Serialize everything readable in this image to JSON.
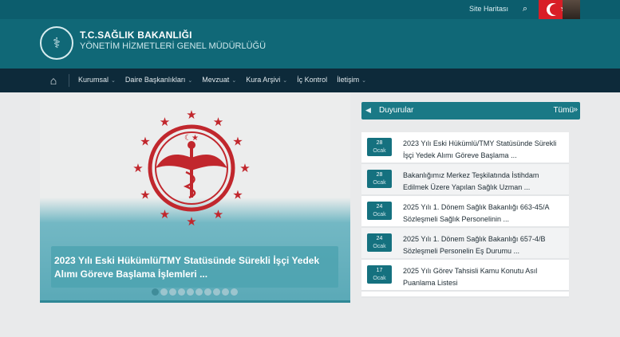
{
  "topbar": {
    "sitemap_label": "Site Haritası",
    "search_icon": "search-icon"
  },
  "header": {
    "title": "T.C.SAĞLIK BAKANLIĞI",
    "subtitle": "YÖNETİM HİZMETLERİ GENEL MÜDÜRLÜĞÜ"
  },
  "nav": {
    "home_icon": "home-icon",
    "items": [
      {
        "label": "Kurumsal",
        "has_menu": true
      },
      {
        "label": "Daire Başkanlıkları",
        "has_menu": true
      },
      {
        "label": "Mevzuat",
        "has_menu": true
      },
      {
        "label": "Kura Arşivi",
        "has_menu": true
      },
      {
        "label": "İç Kontrol",
        "has_menu": false
      },
      {
        "label": "İletişim",
        "has_menu": true
      }
    ]
  },
  "slider": {
    "caption": "2023 Yılı Eski Hükümlü/TMY Statüsünde Sürekli İşçi Yedek Alımı Göreve Başlama İşlemleri ...",
    "dot_count": 10,
    "active_dot": 0,
    "emblem_color": "#c1272d"
  },
  "announcements": {
    "title": "Duyurular",
    "all_label": "Tümü",
    "items": [
      {
        "day": "28",
        "month": "Ocak",
        "title": "2023 Yılı Eski Hükümlü/TMY Statüsünde Sürekli İşçi Yedek Alımı Göreve Başlama ..."
      },
      {
        "day": "28",
        "month": "Ocak",
        "title": "Bakanlığımız Merkez Teşkilatında İstihdam Edilmek Üzere Yapılan Sağlık Uzman ..."
      },
      {
        "day": "24",
        "month": "Ocak",
        "title": "2025 Yılı 1. Dönem Sağlık Bakanlığı 663-45/A Sözleşmeli Sağlık Personelinin ..."
      },
      {
        "day": "24",
        "month": "Ocak",
        "title": "2025 Yılı 1. Dönem Sağlık Bakanlığı 657-4/B Sözleşmeli Personelin Eş Durumu ..."
      },
      {
        "day": "17",
        "month": "Ocak",
        "title": "2025 Yılı Görev Tahsisli Kamu Konutu Asıl Puanlama Listesi"
      }
    ]
  },
  "colors": {
    "header_teal": "#106877",
    "nav_dark": "#0d2a3a",
    "accent": "#15717f"
  }
}
